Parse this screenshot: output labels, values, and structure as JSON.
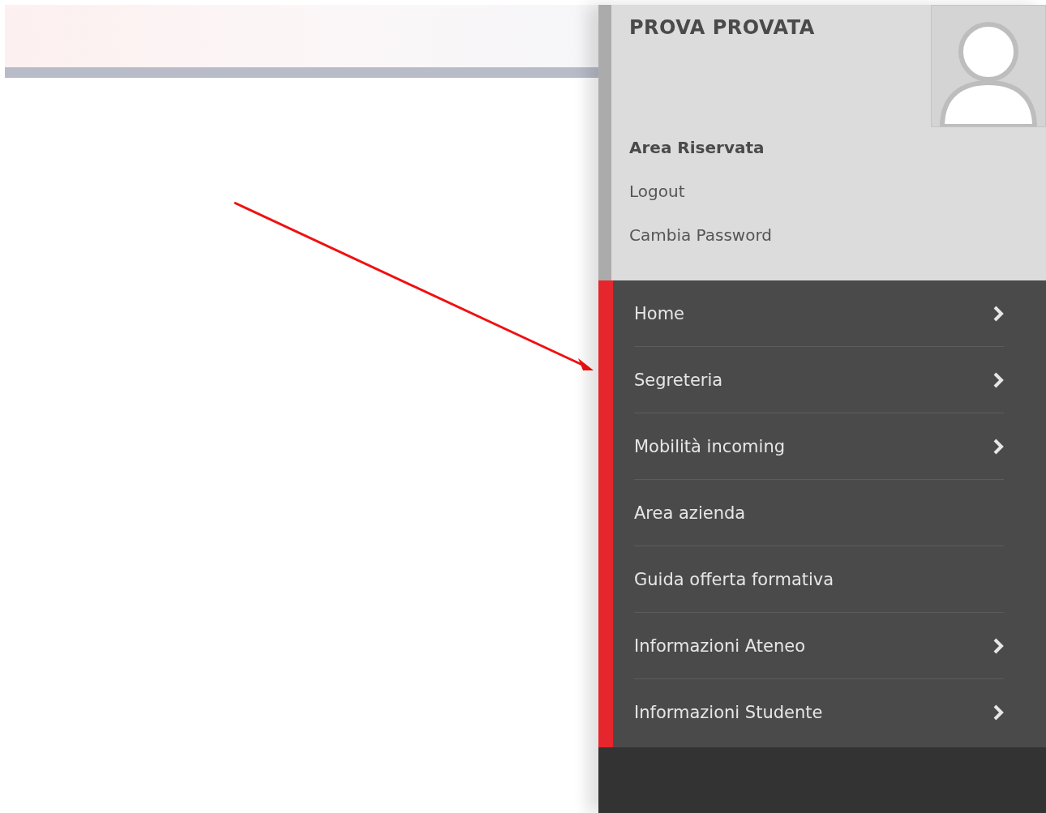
{
  "user": {
    "name": "PROVA PROVATA",
    "section_title": "Area Riservata",
    "links": [
      "Logout",
      "Cambia Password"
    ]
  },
  "menu": [
    {
      "label": "Home",
      "has_submenu": true
    },
    {
      "label": "Segreteria",
      "has_submenu": true
    },
    {
      "label": "Mobilità incoming",
      "has_submenu": true
    },
    {
      "label": "Area azienda",
      "has_submenu": false
    },
    {
      "label": "Guida offerta formativa",
      "has_submenu": false
    },
    {
      "label": "Informazioni Ateneo",
      "has_submenu": true
    },
    {
      "label": "Informazioni Studente",
      "has_submenu": true
    }
  ]
}
